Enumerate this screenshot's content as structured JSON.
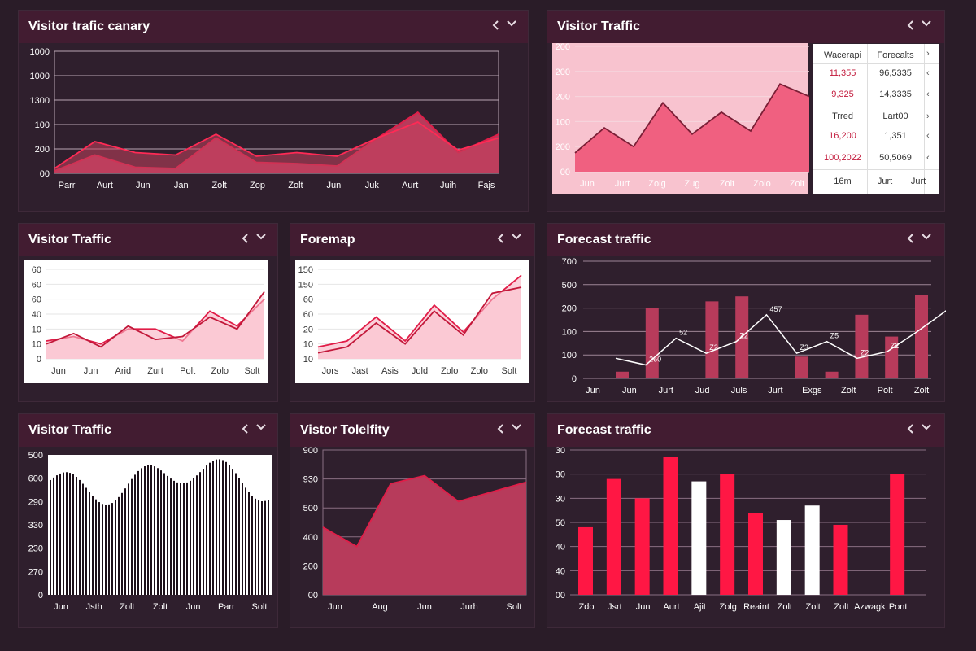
{
  "colors": {
    "bg": "#2a1c28",
    "panel": "#2f1f2d",
    "header": "#421c31",
    "accent": "#e11d48",
    "fill_dark": "#b73b5b",
    "fill_light": "#f9c4d0",
    "line": "#e11d48"
  },
  "icons": {
    "prev": "chevron-left-icon",
    "next": "chevron-down-icon"
  },
  "panels": [
    {
      "title": "Visitor trafic canary"
    },
    {
      "title": "Visitor Traffic"
    },
    {
      "title": "Visitor Traffic"
    },
    {
      "title": "Foremap"
    },
    {
      "title": "Forecast traffic"
    },
    {
      "title": "Visitor Traffic"
    },
    {
      "title": "Vistor Tolelfity"
    },
    {
      "title": "Forecast traffic"
    }
  ],
  "table": {
    "headers": [
      "Wacerapi",
      "Forecalts"
    ],
    "rows": [
      [
        "11,355",
        "96,5335"
      ],
      [
        "9,325",
        "14,3335"
      ],
      [
        "Trred",
        "Lart00"
      ],
      [
        "16,200",
        "1,351"
      ],
      [
        "100,2022",
        "50,5069"
      ]
    ],
    "footer": [
      "16m",
      "Jurt",
      "Jurt"
    ]
  },
  "chart_data": [
    {
      "type": "area",
      "title": "Visitor trafic canary",
      "categories": [
        "Parr",
        "Aurt",
        "Jun",
        "Jan",
        "Zolt",
        "Zop",
        "Zolt",
        "Jun",
        "Juk",
        "Aurt",
        "Juih",
        "Fajs"
      ],
      "yticks": [
        "1000",
        "1000",
        "1300",
        "100",
        "200",
        "00"
      ],
      "ylim": [
        0,
        1000
      ],
      "series": [
        {
          "values": [
            20,
            150,
            50,
            40,
            290,
            90,
            80,
            60,
            290,
            500,
            170,
            320
          ]
        },
        {
          "values": [
            40,
            260,
            170,
            150,
            320,
            140,
            170,
            140,
            290,
            420,
            190,
            290
          ]
        }
      ]
    },
    {
      "type": "area",
      "title": "Visitor Traffic",
      "categories": [
        "Jun",
        "Jurt",
        "Zolg",
        "Zug",
        "Zolt",
        "Zolo",
        "Zolt"
      ],
      "yticks": [
        "200",
        "200",
        "200",
        "100",
        "200",
        "00"
      ],
      "ylim": [
        0,
        200
      ],
      "series": [
        {
          "values": [
            30,
            70,
            40,
            110,
            60,
            95,
            65,
            140,
            120
          ]
        }
      ]
    },
    {
      "type": "area",
      "title": "Visitor Traffic",
      "categories": [
        "Jun",
        "Jun",
        "Arid",
        "Zurt",
        "Polt",
        "Zolo",
        "Solt"
      ],
      "yticks": [
        "60",
        "60",
        "60",
        "40",
        "10",
        "10",
        "0"
      ],
      "ylim": [
        0,
        60
      ],
      "series": [
        {
          "values": [
            12,
            15,
            10,
            20,
            20,
            12,
            32,
            22,
            40
          ]
        },
        {
          "values": [
            10,
            17,
            8,
            22,
            13,
            15,
            28,
            20,
            45
          ]
        }
      ]
    },
    {
      "type": "area",
      "title": "Foremap",
      "categories": [
        "Jors",
        "Jast",
        "Asis",
        "Jold",
        "Zolo",
        "Zolo",
        "Solt"
      ],
      "yticks": [
        "150",
        "150",
        "60",
        "60",
        "20",
        "10",
        "10"
      ],
      "ylim": [
        0,
        150
      ],
      "series": [
        {
          "values": [
            20,
            30,
            70,
            30,
            90,
            45,
            100,
            140
          ]
        },
        {
          "values": [
            10,
            20,
            60,
            25,
            80,
            40,
            110,
            120
          ]
        }
      ]
    },
    {
      "type": "bar",
      "title": "Forecast traffic",
      "categories": [
        "Jun",
        "Jun",
        "Jurt",
        "Jud",
        "Juls",
        "Jurt",
        "Exgs",
        "Zolt",
        "Polt",
        "Zolt"
      ],
      "yticks": [
        "700",
        "500",
        "200",
        "100",
        "100",
        "0"
      ],
      "ylim": [
        0,
        700
      ],
      "bars": [
        40,
        420,
        0,
        460,
        490,
        0,
        130,
        40,
        380,
        250,
        500
      ],
      "line": [
        120,
        80,
        240,
        150,
        220,
        380,
        150,
        220,
        120,
        160,
        280,
        410
      ],
      "annotations": [
        "260",
        "52",
        "Z2",
        "Z2",
        "457",
        "Z3",
        "Z5",
        "Z2",
        "Z2"
      ]
    },
    {
      "type": "bar",
      "title": "Visitor Traffic",
      "categories": [
        "Jun",
        "Jsth",
        "Zolt",
        "Zolt",
        "Jun",
        "Parr",
        "Solt"
      ],
      "yticks": [
        "500",
        "600",
        "290",
        "330",
        "230",
        "270",
        "0"
      ],
      "ylim": [
        0,
        650
      ]
    },
    {
      "type": "area",
      "title": "Vistor Tolelfity",
      "categories": [
        "Jun",
        "Aug",
        "Jun",
        "Jurh",
        "Solt"
      ],
      "yticks": [
        "900",
        "930",
        "500",
        "400",
        "200",
        "00"
      ],
      "ylim": [
        0,
        900
      ],
      "series": [
        {
          "values": [
            420,
            300,
            690,
            740,
            580,
            640,
            700
          ]
        }
      ]
    },
    {
      "type": "bar",
      "title": "Forecast traffic",
      "categories": [
        "Zdo",
        "Jsrt",
        "Jun",
        "Aurt",
        "Ajit",
        "Zolg",
        "Reaint",
        "Zolt",
        "Zolt",
        "Zolt",
        "Azwagk",
        "Pont"
      ],
      "yticks": [
        "30",
        "30",
        "30",
        "50",
        "40",
        "40",
        "00"
      ],
      "ylim": [
        0,
        60
      ],
      "series": [
        {
          "name": "",
          "values": [
            28,
            48,
            40,
            57,
            0,
            50,
            34,
            0,
            0,
            29,
            0,
            50
          ]
        },
        {
          "name": "",
          "values": [
            0,
            0,
            0,
            0,
            47,
            0,
            0,
            31,
            37,
            0,
            0,
            0
          ]
        }
      ]
    }
  ]
}
